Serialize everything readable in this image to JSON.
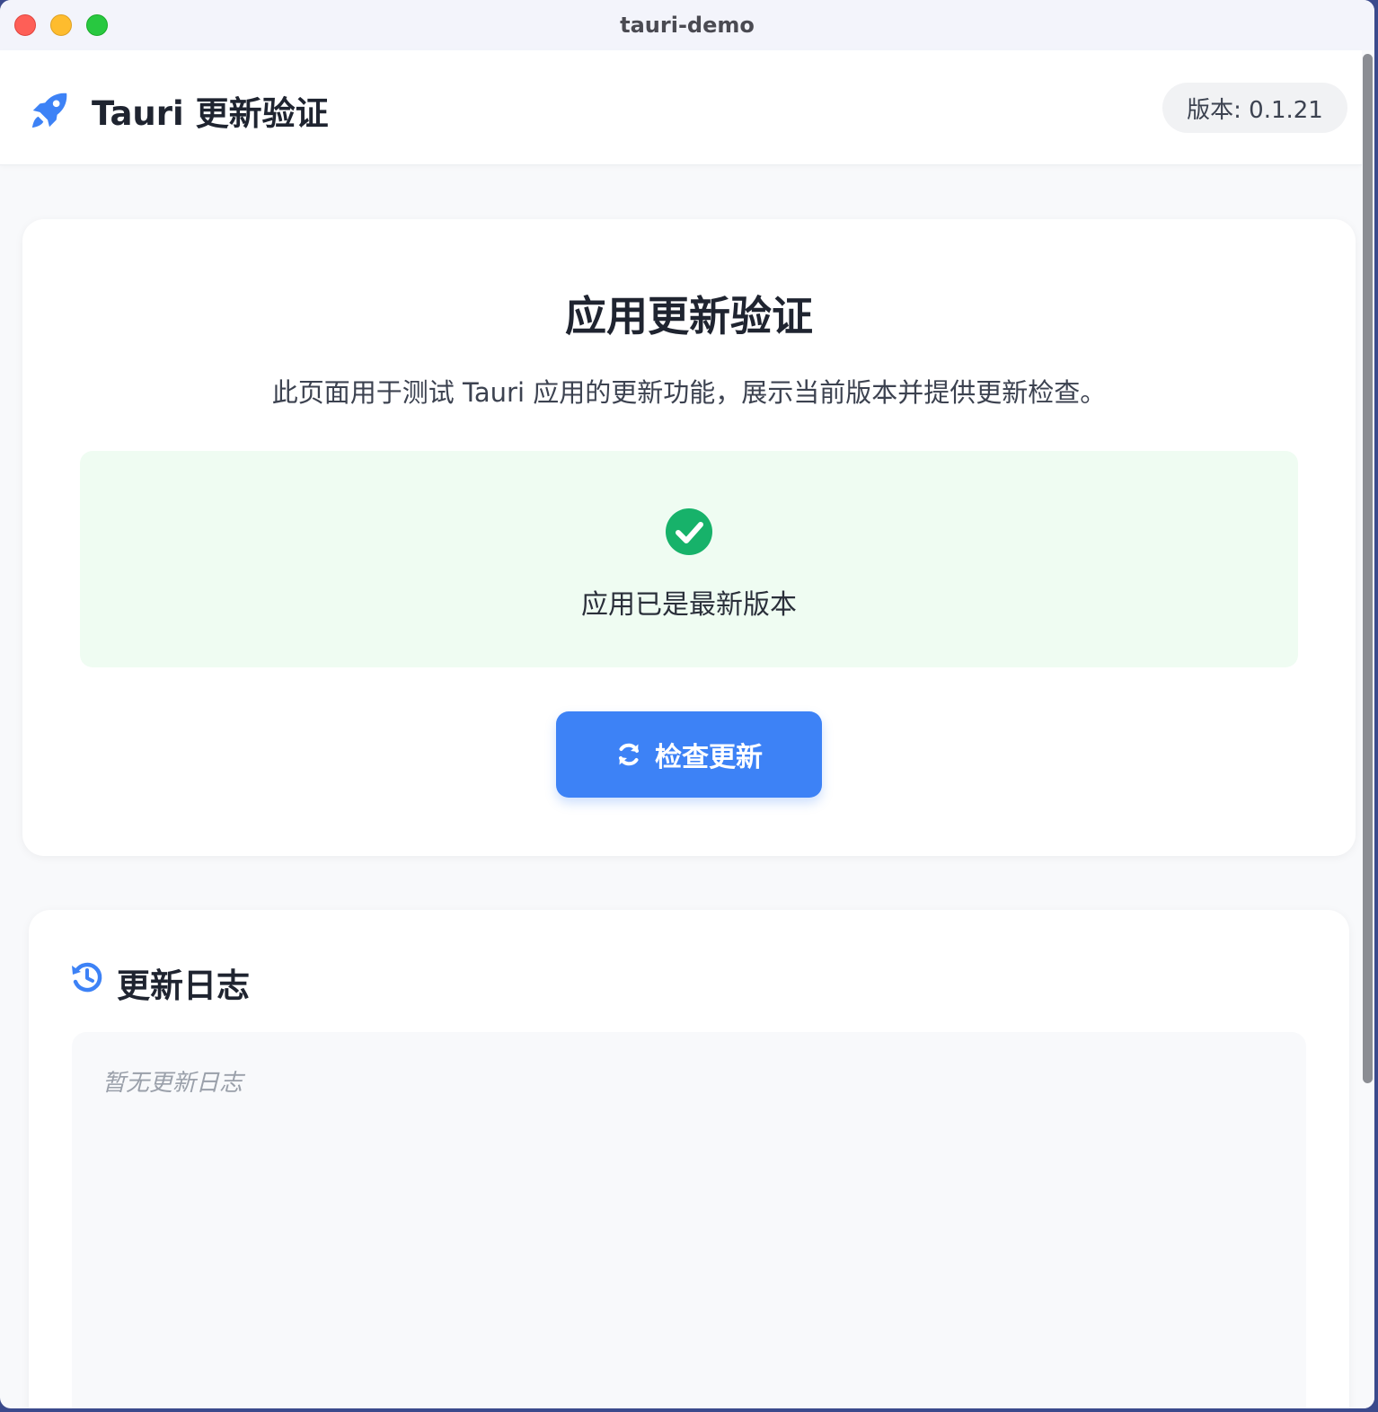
{
  "window": {
    "title": "tauri-demo"
  },
  "header": {
    "logo_icon": "rocket-icon",
    "title": "Tauri 更新验证",
    "version_label": "版本: 0.1.21"
  },
  "main_card": {
    "title": "应用更新验证",
    "description": "此页面用于测试 Tauri 应用的更新功能，展示当前版本并提供更新检查。",
    "status": {
      "icon": "check-circle-icon",
      "text": "应用已是最新版本"
    },
    "check_button": {
      "icon": "refresh-icon",
      "label": "检查更新"
    }
  },
  "changelog": {
    "icon": "history-icon",
    "title": "更新日志",
    "empty_text": "暂无更新日志"
  },
  "colors": {
    "accent": "#3d82f6",
    "success": "#17b26a",
    "success_bg": "#effcf2"
  }
}
